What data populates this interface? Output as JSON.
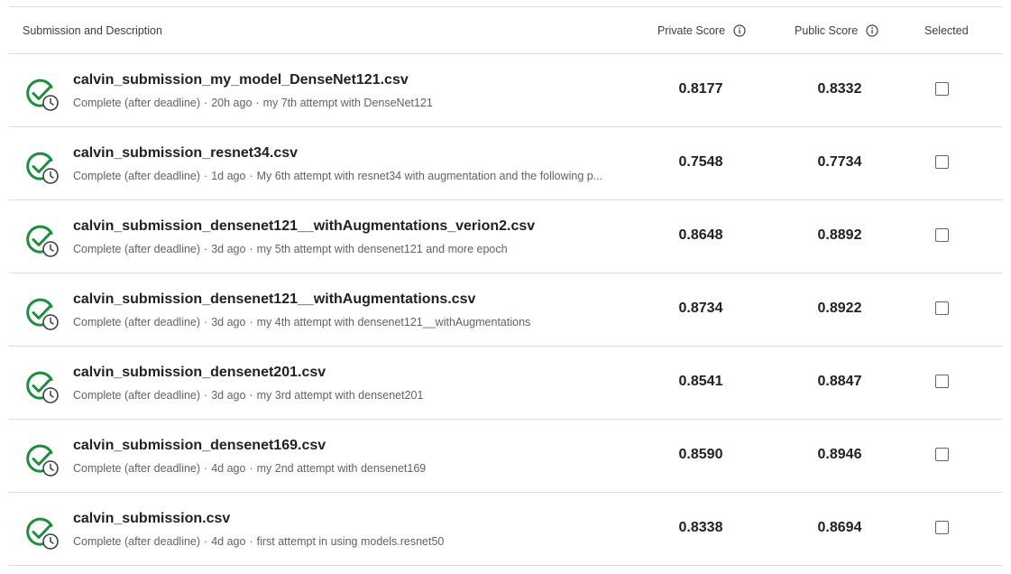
{
  "header": {
    "description": "Submission and Description",
    "private": "Private Score",
    "public": "Public Score",
    "selected": "Selected"
  },
  "colors": {
    "success": "#1e8e3e",
    "text": "#202124",
    "muted": "#5f6368",
    "divider": "#dadce0"
  },
  "rows": [
    {
      "title": "calvin_submission_my_model_DenseNet121.csv",
      "status": "Complete (after deadline)",
      "time": "20h ago",
      "description": "my 7th attempt with DenseNet121",
      "private": "0.8177",
      "public": "0.8332",
      "selected": false
    },
    {
      "title": "calvin_submission_resnet34.csv",
      "status": "Complete (after deadline)",
      "time": "1d ago",
      "description": "My 6th attempt with resnet34 with augmentation and the following p...",
      "private": "0.7548",
      "public": "0.7734",
      "selected": false
    },
    {
      "title": "calvin_submission_densenet121__withAugmentations_verion2.csv",
      "status": "Complete (after deadline)",
      "time": "3d ago",
      "description": "my 5th attempt with densenet121 and more epoch",
      "private": "0.8648",
      "public": "0.8892",
      "selected": false
    },
    {
      "title": "calvin_submission_densenet121__withAugmentations.csv",
      "status": "Complete (after deadline)",
      "time": "3d ago",
      "description": "my 4th attempt with densenet121__withAugmentations",
      "private": "0.8734",
      "public": "0.8922",
      "selected": false
    },
    {
      "title": "calvin_submission_densenet201.csv",
      "status": "Complete (after deadline)",
      "time": "3d ago",
      "description": "my 3rd attempt with densenet201",
      "private": "0.8541",
      "public": "0.8847",
      "selected": false
    },
    {
      "title": "calvin_submission_densenet169.csv",
      "status": "Complete (after deadline)",
      "time": "4d ago",
      "description": "my 2nd attempt with densenet169",
      "private": "0.8590",
      "public": "0.8946",
      "selected": false
    },
    {
      "title": "calvin_submission.csv",
      "status": "Complete (after deadline)",
      "time": "4d ago",
      "description": "first attempt in using models.resnet50",
      "private": "0.8338",
      "public": "0.8694",
      "selected": false
    }
  ]
}
